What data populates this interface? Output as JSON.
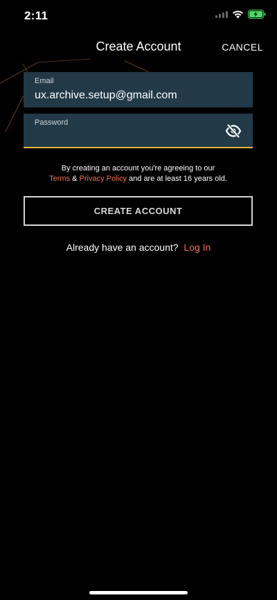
{
  "status_bar": {
    "time": "2:11"
  },
  "nav": {
    "title": "Create Account",
    "cancel_label": "CANCEL"
  },
  "form": {
    "email_label": "Email",
    "email_value": "ux.archive.setup@gmail.com",
    "password_label": "Password",
    "password_value": "",
    "password_toggle_icon": "eye-slash-icon"
  },
  "agreement": {
    "line1": "By creating an account you're agreeing to our",
    "terms_link": "Terms",
    "ampersand": "&",
    "privacy_link": "Privacy Policy",
    "line2_suffix": "and are at least 16 years old."
  },
  "create_button_label": "CREATE ACCOUNT",
  "login": {
    "prompt": "Already have an account?",
    "link": "Log In"
  },
  "colors": {
    "background": "#000000",
    "field_background": "#223947",
    "accent_orange": "#f0714a",
    "focus_underline": "#e7b833",
    "battery_green": "#4cd964"
  }
}
